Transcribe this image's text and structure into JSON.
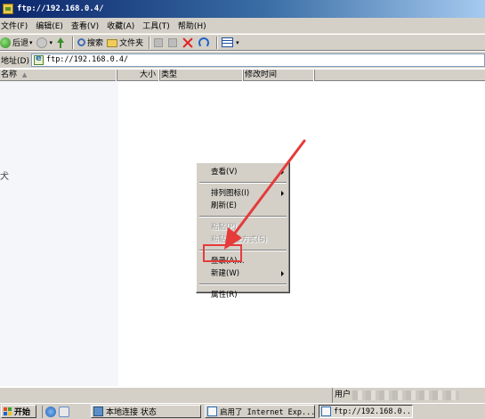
{
  "window": {
    "title": "ftp://192.168.0.4/"
  },
  "menubar": [
    "文件(F)",
    "编辑(E)",
    "查看(V)",
    "收藏(A)",
    "工具(T)",
    "帮助(H)"
  ],
  "toolbar": {
    "back_label": "后退",
    "search_label": "搜索",
    "folders_label": "文件夹"
  },
  "address": {
    "label": "地址(D)",
    "value": "ftp://192.168.0.4/"
  },
  "columns": {
    "name": "名称",
    "size": "大小",
    "type": "类型",
    "modified": "修改时间"
  },
  "left_panel": {
    "fragment": "犬"
  },
  "context_menu": {
    "view": "查看(V)",
    "arrange": "排列图标(I)",
    "refresh": "刷新(E)",
    "paste": "粘贴(P)",
    "paste_shortcut": "粘贴快捷方式(S)",
    "login": "登录(A)...",
    "new": "新建(W)",
    "properties": "属性(R)"
  },
  "annotation": {
    "color": "#e53b3b"
  },
  "statusbar": {
    "user_label": "用户"
  },
  "taskbar": {
    "start_label": "开始",
    "tasks": [
      {
        "label": "本地连接 状态",
        "active": false
      },
      {
        "label": "启用了 Internet Exp...",
        "active": false
      },
      {
        "label": "ftp://192.168.0...",
        "active": true
      }
    ]
  }
}
